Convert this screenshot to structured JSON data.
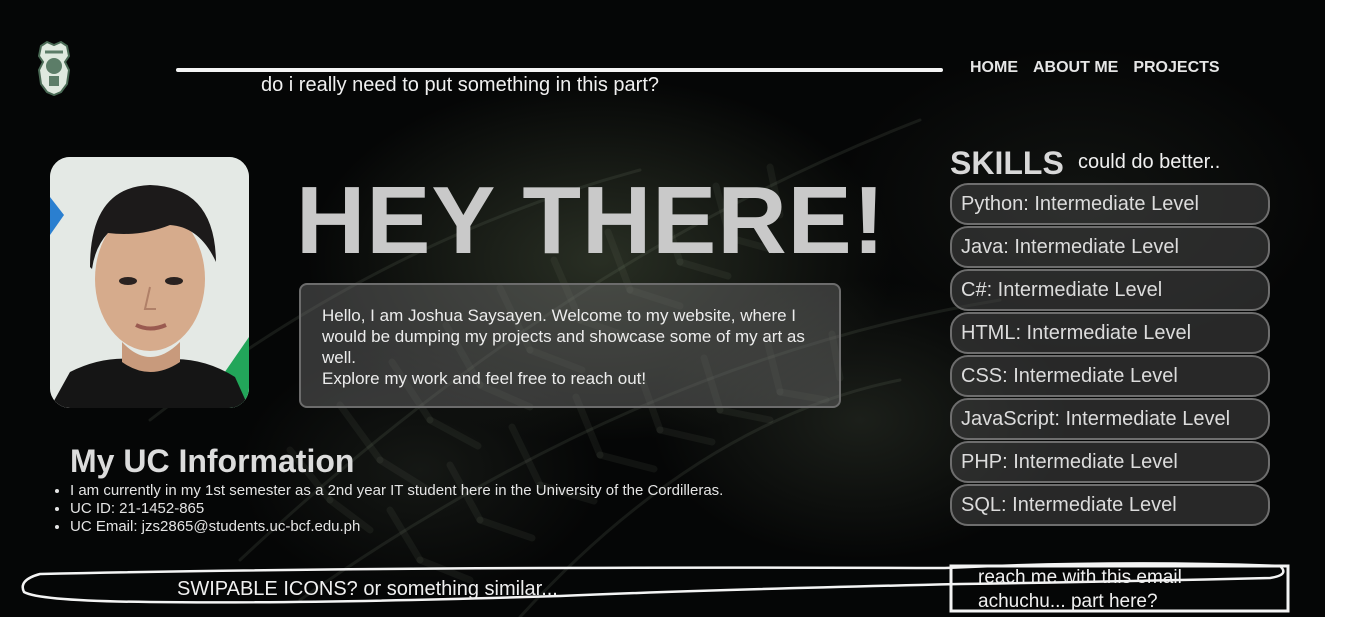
{
  "header": {
    "note": "do i really need to put something in this part?",
    "nav": [
      "HOME",
      "ABOUT ME",
      "PROJECTS"
    ]
  },
  "hero": {
    "title": "HEY THERE!",
    "intro_lines": [
      "Hello, I am Joshua Saysayen. Welcome to my website, where I would be dumping my projects and showcase some of my art as well.",
      "Explore my work and feel free to reach out!"
    ]
  },
  "uc_info": {
    "title": "My UC Information",
    "items": [
      "I am currently in my 1st semester as a 2nd year IT student here in the University of the Cordilleras.",
      "UC ID: 21-1452-865",
      "UC Email: jzs2865@students.uc-bcf.edu.ph"
    ]
  },
  "skills": {
    "title": "SKILLS",
    "note": "could do better..",
    "items": [
      "Python: Intermediate Level",
      "Java: Intermediate Level",
      "C#: Intermediate Level",
      "HTML: Intermediate Level",
      "CSS: Intermediate Level",
      "JavaScript: Intermediate Level",
      "PHP: Intermediate Level",
      "SQL: Intermediate Level"
    ]
  },
  "footer": {
    "left_note": "SWIPABLE ICONS? or something similar...",
    "right_note_lines": [
      "reach me with this email",
      "achuchu... part here?"
    ]
  },
  "colors": {
    "background": "#050606",
    "accent_text": "#c9c9c9",
    "pill_border": "#6e6e6e"
  }
}
